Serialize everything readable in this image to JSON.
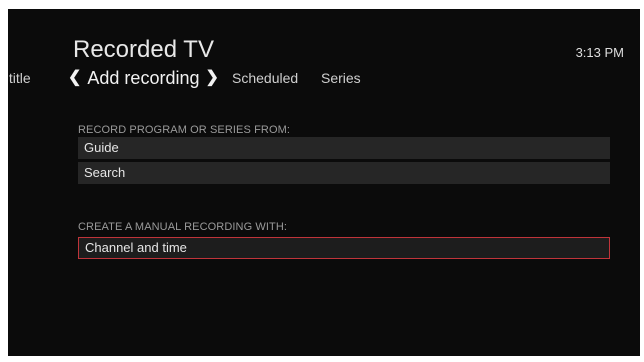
{
  "header": {
    "title": "Recorded TV",
    "time": "3:13 PM"
  },
  "tabs": {
    "prev_partial": "y title",
    "active": "Add recording",
    "chevron_left": "❮",
    "chevron_right": "❯",
    "scheduled": "Scheduled",
    "series": "Series"
  },
  "sections": {
    "record_from": {
      "label": "RECORD PROGRAM OR SERIES FROM:",
      "items": [
        "Guide",
        "Search"
      ]
    },
    "manual": {
      "label": "CREATE A MANUAL RECORDING WITH:",
      "items": [
        "Channel and time"
      ]
    }
  },
  "colors": {
    "background": "#0b0b0b",
    "row": "#262626",
    "focus_border": "#c0343a",
    "section_label": "#9a9a9a"
  }
}
